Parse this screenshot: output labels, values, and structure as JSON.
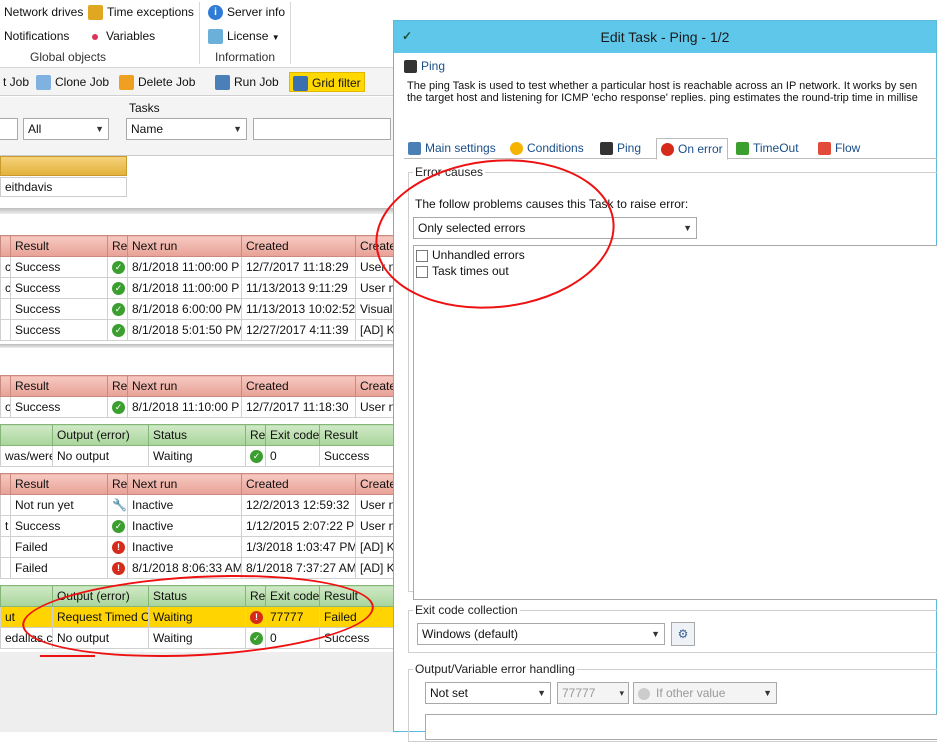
{
  "ribbon": {
    "items": {
      "network_drives": "Network drives",
      "time_exceptions": "Time exceptions",
      "notifications": "Notifications",
      "variables": "Variables",
      "server_info": "Server info",
      "license": "License"
    },
    "groups": {
      "global_objects": "Global objects",
      "information": "Information"
    }
  },
  "toolbar": {
    "new_job": "t Job",
    "clone_job": "Clone Job",
    "delete_job": "Delete Job",
    "run_job": "Run Job",
    "grid_filter": "Grid filter"
  },
  "filters": {
    "tasks_label": "Tasks",
    "filter1_value": "All",
    "filter2_value": "Name"
  },
  "group_header": {
    "user": "eithdavis"
  },
  "grid1": {
    "headers": [
      "Result",
      "Re",
      "Next run",
      "Created",
      "Created"
    ],
    "rows": [
      {
        "left": "c",
        "result": "Success",
        "status": "ok",
        "next": "8/1/2018 11:00:00 P",
        "created": "12/7/2017 11:18:29",
        "by": "User n"
      },
      {
        "left": "c",
        "result": "Success",
        "status": "ok",
        "next": "8/1/2018 11:00:00 P",
        "created": "11/13/2013 9:11:29",
        "by": "User n"
      },
      {
        "left": "",
        "result": "Success",
        "status": "ok",
        "next": "8/1/2018 6:00:00 PM",
        "created": "11/13/2013 10:02:52",
        "by": "Visual"
      },
      {
        "left": "",
        "result": "Success",
        "status": "ok",
        "next": "8/1/2018 5:01:50 PM",
        "created": "12/27/2017 4:11:39",
        "by": "[AD] K"
      }
    ]
  },
  "grid2": {
    "headers": [
      "Result",
      "Re",
      "Next run",
      "Created",
      "Created"
    ],
    "rows": [
      {
        "left": "ol",
        "result": "Success",
        "status": "ok",
        "next": "8/1/2018 11:10:00 P",
        "created": "12/7/2017 11:18:30",
        "by": "User n"
      }
    ]
  },
  "grid3": {
    "headers": [
      "Output (error)",
      "Status",
      "Re",
      "Exit code",
      "Result"
    ],
    "rows": [
      {
        "left": "was/were",
        "output": "No output",
        "status": "Waiting",
        "st": "ok",
        "exit": "0",
        "result": "Success"
      }
    ]
  },
  "grid4": {
    "headers": [
      "Result",
      "Re",
      "Next run",
      "Created",
      "Created"
    ],
    "rows": [
      {
        "left": "",
        "result": "Not run yet",
        "status": "wr",
        "next": "Inactive",
        "created": "12/2/2013 12:59:32",
        "by": "User n"
      },
      {
        "left": "t",
        "result": "Success",
        "status": "ok",
        "next": "Inactive",
        "created": "1/12/2015 2:07:22 P",
        "by": "User n"
      },
      {
        "left": "",
        "result": "Failed",
        "status": "err",
        "next": "Inactive",
        "created": "1/3/2018 1:03:47 PM",
        "by": "[AD] K"
      },
      {
        "left": "",
        "result": "Failed",
        "status": "err",
        "next": "8/1/2018 8:06:33 AM",
        "created": "8/1/2018 7:37:27 AM",
        "by": "[AD] K"
      }
    ]
  },
  "grid5": {
    "headers": [
      "Output (error)",
      "Status",
      "Re",
      "Exit code",
      "Result"
    ],
    "rows": [
      {
        "left": "ut",
        "output": "Request Timed O",
        "status": "Waiting",
        "st": "err",
        "exit": "77777",
        "result": "Failed",
        "highlight": true
      },
      {
        "left": "edallas.co",
        "output": "No output",
        "status": "Waiting",
        "st": "ok",
        "exit": "0",
        "result": "Success",
        "highlight": false
      }
    ]
  },
  "dialog": {
    "title": "Edit Task - Ping - 1/2",
    "task_name": "Ping",
    "description_line1": "The ping Task is used to test whether a particular host is reachable across an IP network. It works by sen",
    "description_line2": "the target host and listening for ICMP 'echo response' replies. ping estimates the round-trip time in millise",
    "tabs": [
      "Main settings",
      "Conditions",
      "Ping",
      "On error",
      "TimeOut",
      "Flow"
    ],
    "active_tab": "On error",
    "error_causes": {
      "legend": "Error causes",
      "intro": "The follow problems causes this Task to raise error:",
      "mode": "Only selected errors",
      "options": [
        "Unhandled errors",
        "Task times out"
      ]
    },
    "exit_code": {
      "legend": "Exit code collection",
      "value": "Windows (default)"
    },
    "output_handling": {
      "legend": "Output/Variable error handling",
      "mode": "Not set",
      "code": "77777",
      "condition": "If other value"
    }
  },
  "colors": {
    "title_bar": "#5fc8ea",
    "grid_filter": "#ffd800",
    "error_row": "#ffd400",
    "annotation": "#e11111"
  }
}
